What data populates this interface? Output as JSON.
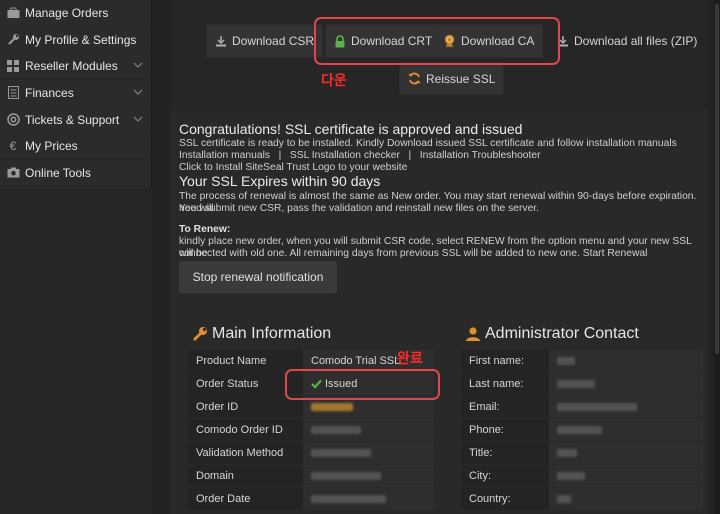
{
  "sidebar": {
    "items": [
      {
        "label": "Manage Orders",
        "icon": "briefcase-icon",
        "has_chevron": false
      },
      {
        "label": "My Profile & Settings",
        "icon": "wrench-icon",
        "has_chevron": false
      },
      {
        "label": "Reseller Modules",
        "icon": "grid-icon",
        "has_chevron": true
      },
      {
        "label": "Finances",
        "icon": "document-icon",
        "has_chevron": true
      },
      {
        "label": "Tickets & Support",
        "icon": "lifebuoy-icon",
        "has_chevron": true
      },
      {
        "label": "My Prices",
        "icon": "euro-icon",
        "has_chevron": false
      },
      {
        "label": "Online Tools",
        "icon": "camera-icon",
        "has_chevron": false
      }
    ]
  },
  "toolbar": {
    "download_csr": "Download CSR",
    "download_crt": "Download CRT",
    "download_ca": "Download CA",
    "download_all": "Download all files (ZIP)",
    "reissue": "Reissue SSL"
  },
  "annotations": {
    "download_note": "다운",
    "complete_note": "완료",
    "highlight_color": "#e0484b"
  },
  "notice": {
    "title": "Congratulations! SSL certificate is approved and issued",
    "line1": "SSL certificate is ready to be installed. Kindly Download issued SSL certificate and follow installation manuals",
    "links": "Installation manuals   |   SSL Installation checker   |   Installation Troubleshooter",
    "line3": "Click to Install SiteSeal Trust Logo to your website",
    "expires_title": "Your SSL Expires within 90 days",
    "expires_text1": "The process of renewal is almost the same as New order. You may start renewal within 90-days before expiration. You will",
    "expires_text2": "need submit new CSR, pass the validation and reinstall new files on the server.",
    "to_renew": "To Renew:",
    "renew_text1": "kindly place new order, when you will submit CSR code, select RENEW from the option menu and your new SSL will be",
    "renew_text2": "connected with old one. All remaining days from previous SSL will be added to new one. Start Renewal",
    "stop_button": "Stop renewal notification"
  },
  "main_info": {
    "title": "Main Information",
    "rows": [
      {
        "label": "Product Name",
        "value": "Comodo Trial SSL"
      },
      {
        "label": "Order Status",
        "value": "Issued"
      },
      {
        "label": "Order ID",
        "value": ""
      },
      {
        "label": "Comodo Order ID",
        "value": ""
      },
      {
        "label": "Validation Method",
        "value": ""
      },
      {
        "label": "Domain",
        "value": ""
      },
      {
        "label": "Order Date",
        "value": ""
      }
    ]
  },
  "admin_contact": {
    "title": "Administrator Contact",
    "rows": [
      {
        "label": "First name:",
        "value": ""
      },
      {
        "label": "Last name:",
        "value": ""
      },
      {
        "label": "Email:",
        "value": ""
      },
      {
        "label": "Phone:",
        "value": ""
      },
      {
        "label": "Title:",
        "value": ""
      },
      {
        "label": "City:",
        "value": ""
      },
      {
        "label": "Country:",
        "value": ""
      }
    ]
  },
  "colors": {
    "success_green": "#5fb34a",
    "refresh_orange": "#e8902a",
    "section_icon_orange": "#e0902e"
  }
}
